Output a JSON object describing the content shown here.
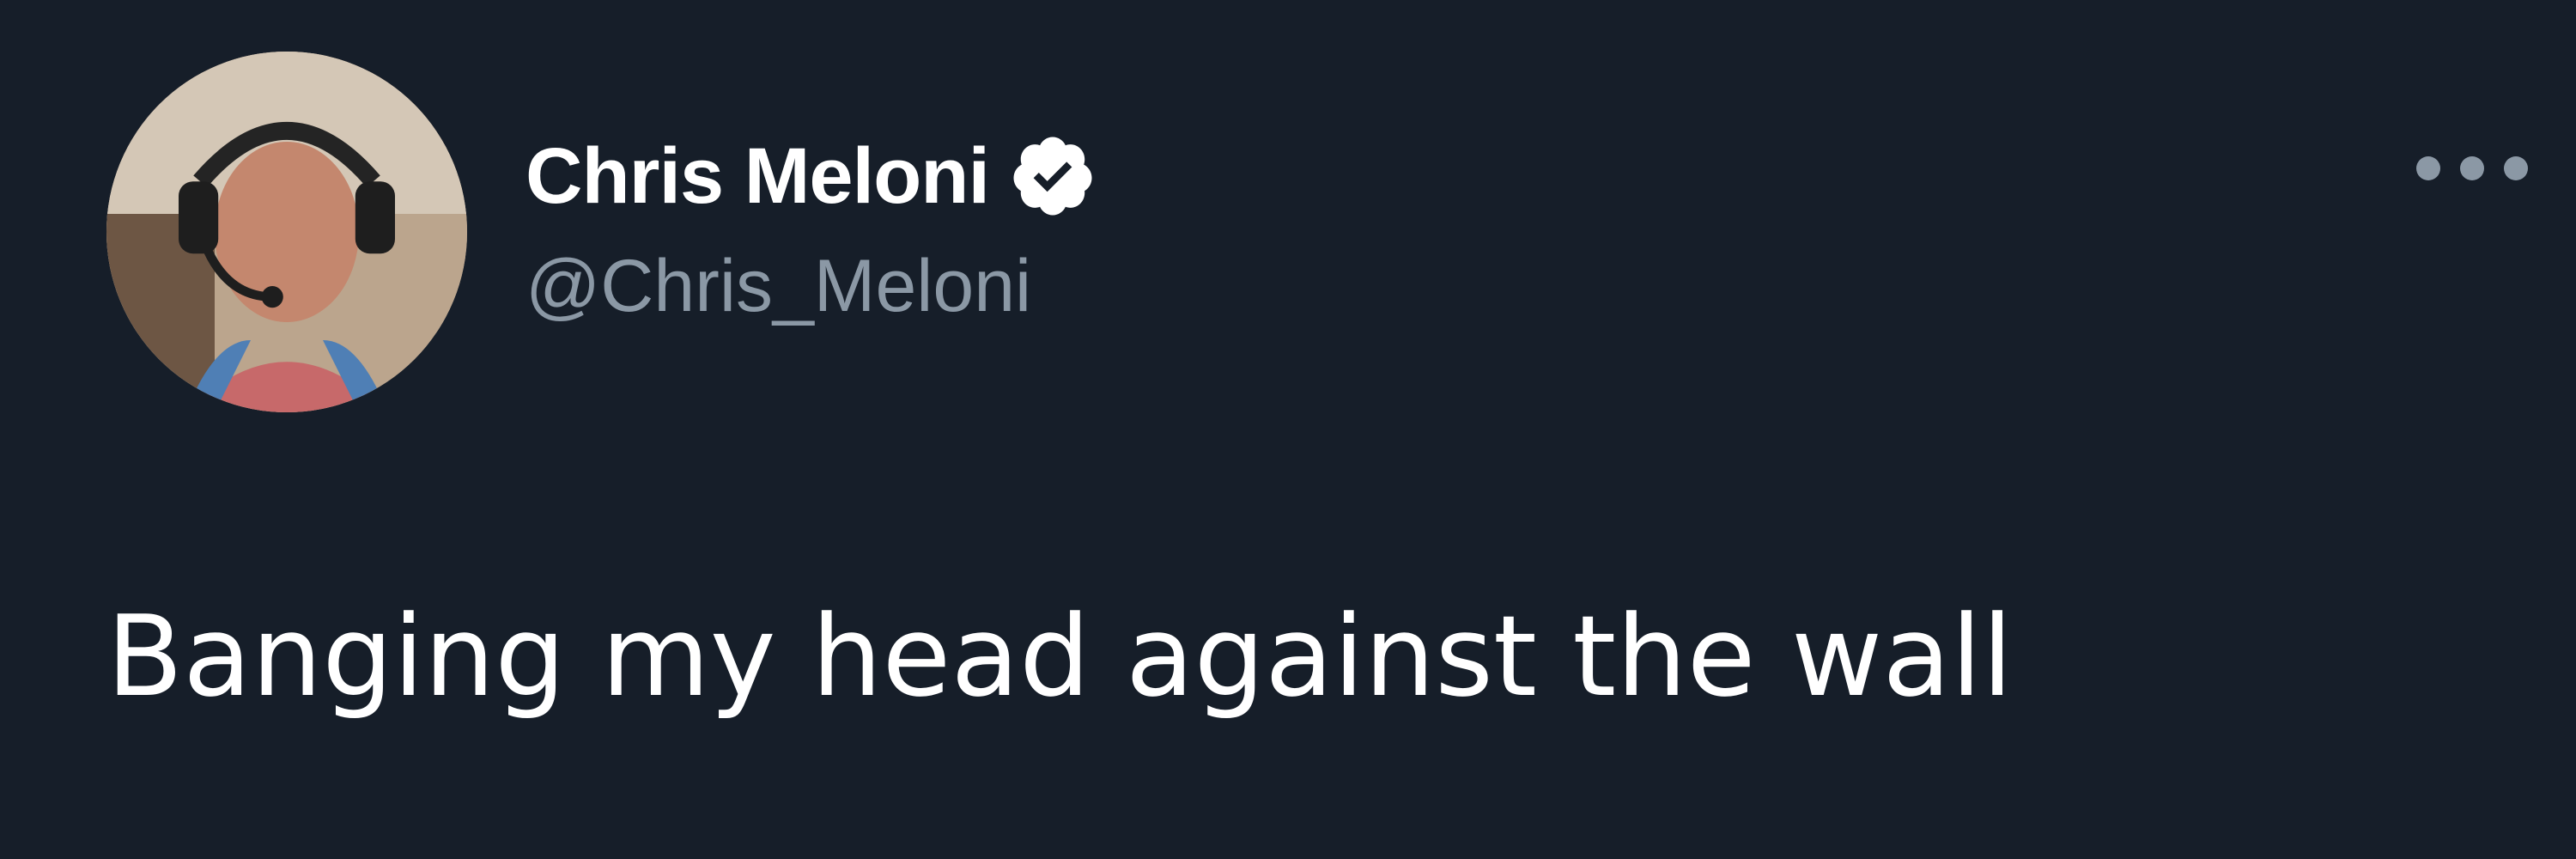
{
  "tweet": {
    "author": {
      "display_name": "Chris Meloni",
      "handle": "@Chris_Meloni",
      "verified": true,
      "avatar_icon": "profile-photo-avatar"
    },
    "text": "Banging my head against the wall",
    "more_icon": "more-options-icon"
  },
  "colors": {
    "background": "#161e29",
    "name_text": "#ffffff",
    "handle_text": "#8b98a5",
    "body_text": "#ffffff",
    "verified_badge": "#ffffff"
  }
}
